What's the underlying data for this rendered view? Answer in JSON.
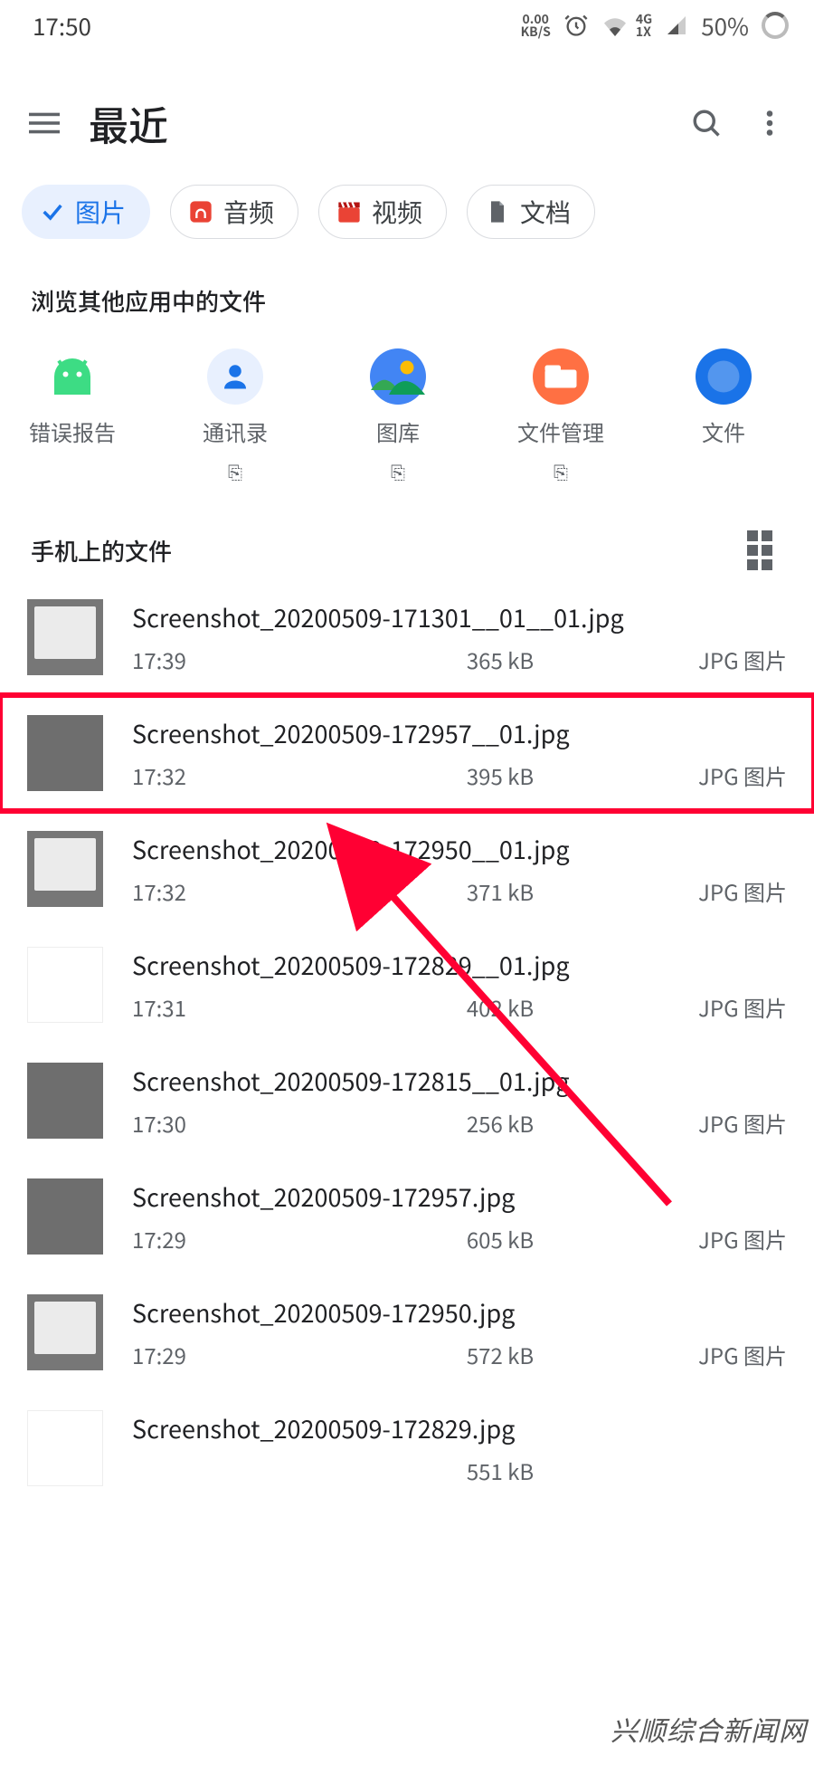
{
  "status": {
    "time": "17:50",
    "kbs_top": "0.00",
    "kbs_bottom": "KB/S",
    "net_top": "4G",
    "net_bottom": "1X",
    "battery": "50%"
  },
  "appbar": {
    "title": "最近"
  },
  "chips": {
    "images": "图片",
    "audio": "音频",
    "video": "视频",
    "docs": "文档"
  },
  "sections": {
    "other_apps": "浏览其他应用中的文件",
    "phone_files": "手机上的文件"
  },
  "app_sources": [
    {
      "label": "错误报告",
      "has_ext": false
    },
    {
      "label": "通讯录",
      "has_ext": true
    },
    {
      "label": "图库",
      "has_ext": true
    },
    {
      "label": "文件管理",
      "has_ext": true
    },
    {
      "label": "文件",
      "has_ext": false
    }
  ],
  "files": [
    {
      "name": "Screenshot_20200509-171301__01__01.jpg",
      "time": "17:39",
      "size": "365 kB",
      "type": "JPG 图片",
      "thumb": "light"
    },
    {
      "name": "Screenshot_20200509-172957__01.jpg",
      "time": "17:32",
      "size": "395 kB",
      "type": "JPG 图片",
      "thumb": "solid",
      "highlight": true
    },
    {
      "name": "Screenshot_20200509-172950__01.jpg",
      "time": "17:32",
      "size": "371 kB",
      "type": "JPG 图片",
      "thumb": "light"
    },
    {
      "name": "Screenshot_20200509-172829__01.jpg",
      "time": "17:31",
      "size": "402 kB",
      "type": "JPG 图片",
      "thumb": "list"
    },
    {
      "name": "Screenshot_20200509-172815__01.jpg",
      "time": "17:30",
      "size": "256 kB",
      "type": "JPG 图片",
      "thumb": "solid"
    },
    {
      "name": "Screenshot_20200509-172957.jpg",
      "time": "17:29",
      "size": "605 kB",
      "type": "JPG 图片",
      "thumb": "solid"
    },
    {
      "name": "Screenshot_20200509-172950.jpg",
      "time": "17:29",
      "size": "572 kB",
      "type": "JPG 图片",
      "thumb": "light"
    },
    {
      "name": "Screenshot_20200509-172829.jpg",
      "time": "",
      "size": "551 kB",
      "type": "",
      "thumb": "list"
    }
  ],
  "watermark": "兴顺综合新闻网",
  "ext_glyph": "⎘"
}
